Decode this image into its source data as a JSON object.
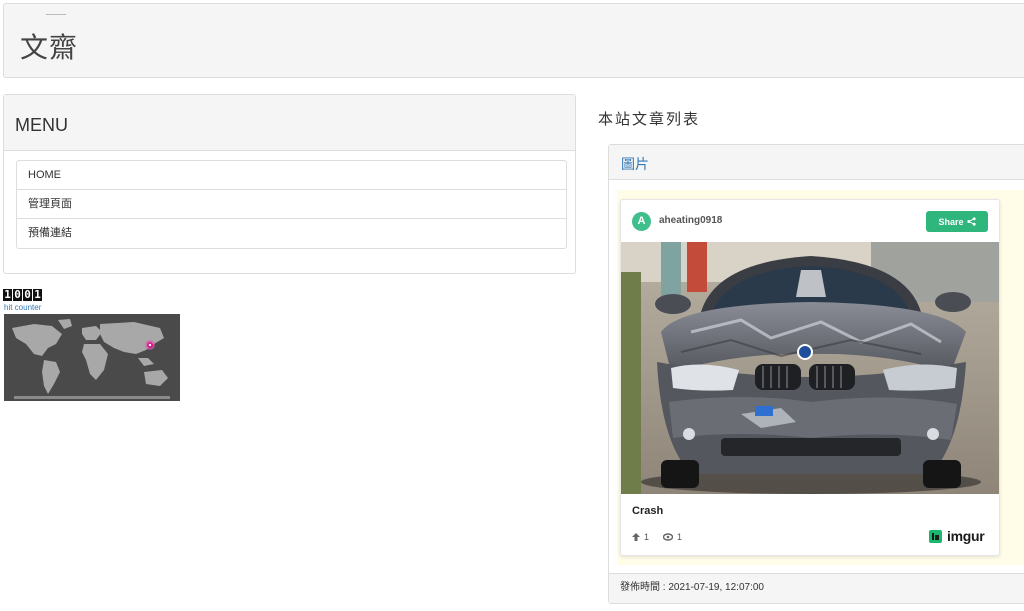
{
  "header": {
    "site_title": "文齋"
  },
  "menu": {
    "title": "MENU",
    "items": [
      {
        "label": "HOME"
      },
      {
        "label": "管理頁面"
      },
      {
        "label": "預備連結"
      }
    ]
  },
  "counter": {
    "digits": [
      "1",
      "0",
      "0",
      "1"
    ],
    "link_text": "hit counter"
  },
  "main": {
    "section_title": "本站文章列表",
    "post": {
      "category": "圖片",
      "published": "發佈時間 : 2021-07-19, 12:07:00",
      "embed": {
        "avatar_letter": "A",
        "username": "aheating0918",
        "share_label": "Share",
        "caption": "Crash",
        "upvotes": "1",
        "views": "1",
        "brand": "imgur"
      }
    }
  }
}
